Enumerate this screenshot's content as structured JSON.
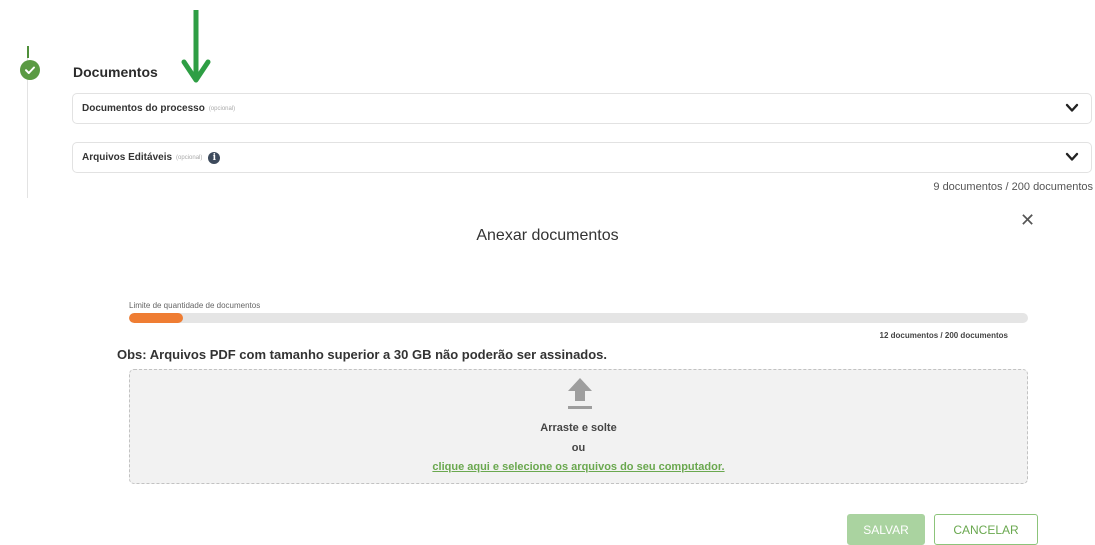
{
  "section": {
    "title": "Documentos",
    "accordions": [
      {
        "label": "Documentos do processo",
        "optional": "(opcional)"
      },
      {
        "label": "Arquivos Editáveis",
        "optional": "(opcional)"
      }
    ],
    "doc_count": "9 documentos / 200 documentos"
  },
  "modal": {
    "title": "Anexar documentos",
    "limit_label": "Limite de quantidade de documentos",
    "limit_count": "12 documentos / 200 documentos",
    "limit_progress": 0.06,
    "obs": "Obs: Arquivos PDF com tamanho superior a 30 GB não poderão ser assinados.",
    "drop_line1": "Arraste e solte",
    "drop_line2": "ou",
    "drop_link": "clique aqui e selecione os arquivos do seu computador.",
    "save_label": "SALVAR",
    "cancel_label": "CANCELAR"
  },
  "colors": {
    "accent_green": "#6aa84f",
    "progress_orange": "#ef7d33",
    "annotation_arrow": "#2e9e44"
  },
  "icons": {
    "step": "check-circle-icon",
    "annotation": "arrow-down-icon",
    "accordion_toggle": "chevron-down-icon",
    "info": "info-icon",
    "close": "close-icon",
    "upload": "upload-icon"
  }
}
